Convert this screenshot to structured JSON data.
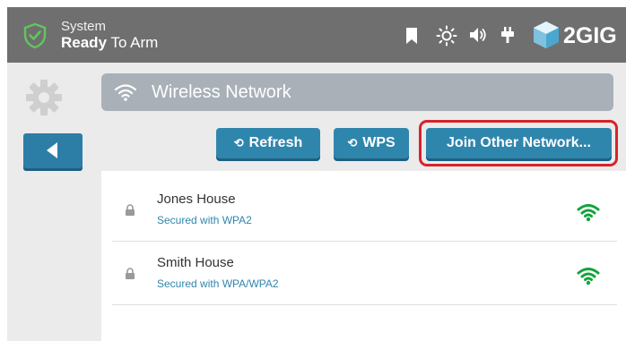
{
  "header": {
    "status_line1": "System",
    "status_bold": "Ready",
    "status_rest": " To Arm",
    "brand": "2GIG",
    "icons": [
      "shield-check-icon",
      "bookmark-icon",
      "brightness-icon",
      "volume-icon",
      "power-plug-icon",
      "brand-cube-icon"
    ]
  },
  "sidebar": {
    "settings_icon": "gear-icon",
    "back_icon": "back-arrow-icon"
  },
  "title_bar": {
    "icon": "wifi-icon",
    "title": "Wireless Network"
  },
  "actions": {
    "refresh_label": "Refresh",
    "wps_label": "WPS",
    "join_label": "Join Other Network..."
  },
  "networks": [
    {
      "name": "Jones House",
      "security": "Secured with WPA2"
    },
    {
      "name": "Smith House",
      "security": "Secured with WPA/WPA2"
    }
  ],
  "colors": {
    "header_bg": "#6f6f6f",
    "accent_blue": "#2f86ad",
    "signal_green": "#12a33b",
    "highlight_red": "#d8232a",
    "shield_green": "#5cb85c"
  }
}
